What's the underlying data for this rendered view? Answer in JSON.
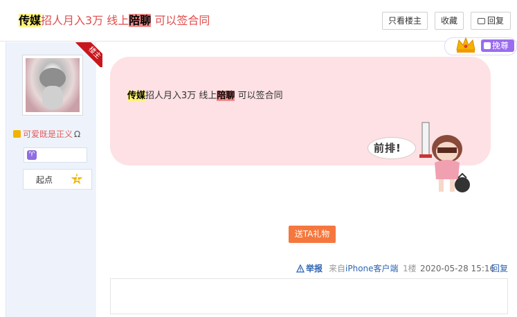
{
  "header": {
    "title_part1": "传媒",
    "title_part2": "招人月入3万 线上",
    "title_part3": "陪聊",
    "title_part4": " 可以签合同",
    "btn_louzhu": "只看楼主",
    "btn_shoucang": "收藏",
    "btn_huifu": "回复"
  },
  "author": {
    "badge_louzhu": "楼主",
    "username": "可爱既是正义",
    "username_suffix": "Ω",
    "level_name": "起点",
    "level_num": "1",
    "aries_symbol": "♈"
  },
  "gift_strip": {
    "ticket_label": "挽尊"
  },
  "post": {
    "text_part1": "传媒",
    "text_part2": "招人月入3万 线上",
    "text_part3": "陪聊",
    "text_part4": " 可以签合同",
    "sticker_text": "前排!"
  },
  "gift_button": "送TA礼物",
  "meta": {
    "report": "举报",
    "from_prefix": "来自",
    "from_client": "iPhone客户端",
    "floor": "1楼",
    "time": "2020-05-28 15:16",
    "reply": "回复"
  },
  "colors": {
    "title_red": "#e04c4c",
    "bubble_pink": "#fde1e4",
    "gift_orange": "#f5773d",
    "link_blue": "#2d64b3"
  }
}
